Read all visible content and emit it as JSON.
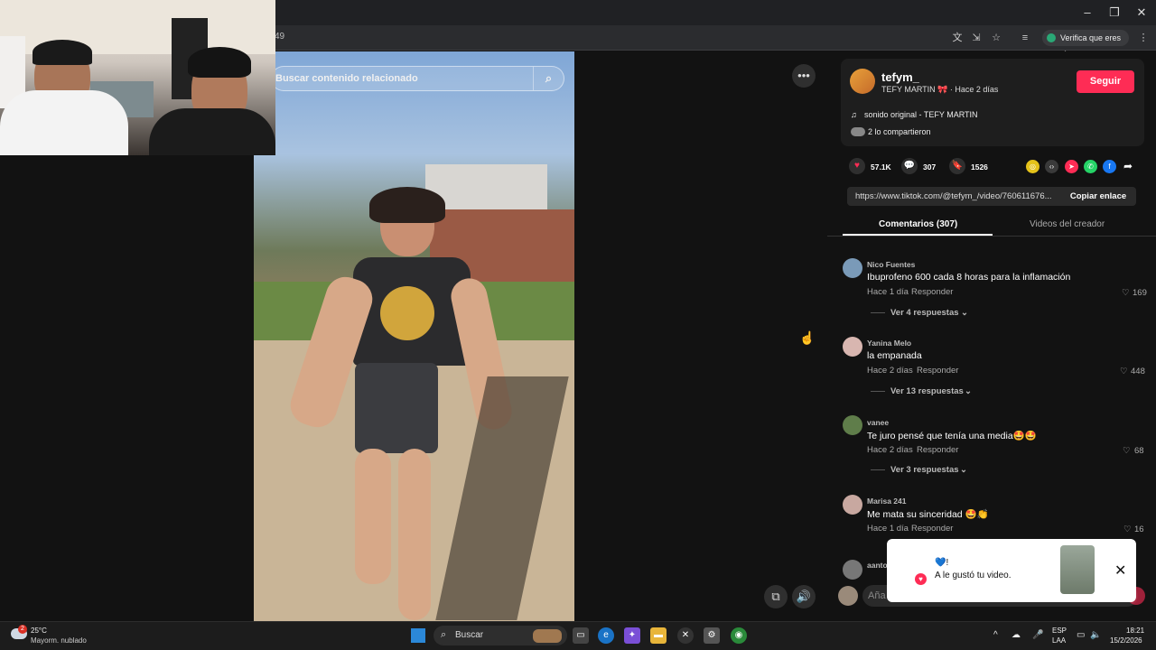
{
  "browser": {
    "url_fragment": "49",
    "verify_chip": "Verifica que eres tú",
    "window_controls": [
      "minimize-icon",
      "restore-icon",
      "close-icon"
    ]
  },
  "video": {
    "search_placeholder": "Buscar contenido relacionado",
    "more_icon": "more-icon",
    "cursor_icon": "hand-cursor-icon"
  },
  "author": {
    "username": "tefym_",
    "display_name": "TEFY MARTIN 🎀 · Hace 2 días",
    "follow_label": "Seguir",
    "sound": "sonido original - TEFY MARTIN",
    "shared": "2 lo compartieron"
  },
  "stats": {
    "likes": "57.1K",
    "comments": "307",
    "saves": "1526"
  },
  "share_colors": [
    "#e5c21a",
    "#3a3a3a",
    "#fe2c55",
    "#25d366",
    "#1877f2"
  ],
  "link": {
    "url": "https://www.tiktok.com/@tefym_/video/760611676...",
    "copy_label": "Copiar enlace"
  },
  "tabs": {
    "comments": "Comentarios (307)",
    "creator_videos": "Videos del creador"
  },
  "comments": [
    {
      "name": "Nico Fuentes",
      "text": "Ibuprofeno 600 cada 8 horas para la inflamación",
      "time": "Hace 1 día",
      "reply": "Responder",
      "likes": "169",
      "replies": "Ver 4 respuestas"
    },
    {
      "name": "Yanina Melo",
      "text": "la empanada",
      "time": "Hace 2 días",
      "reply": "Responder",
      "likes": "448",
      "replies": "Ver 13 respuestas"
    },
    {
      "name": "vanee",
      "text": "Te juro pensé que tenía una media🤩🤩",
      "time": "Hace 2 días",
      "reply": "Responder",
      "likes": "68",
      "replies": "Ver 3 respuestas"
    },
    {
      "name": "Marisa 241",
      "text": "Me mata su sinceridad 🤩👏",
      "time": "Hace 1 día",
      "reply": "Responder",
      "likes": "16"
    },
    {
      "name": "aanto"
    }
  ],
  "toast": {
    "hearts": "💙!",
    "message": "A le gustó tu video."
  },
  "comment_input": {
    "placeholder": "Aña"
  },
  "taskbar": {
    "weather_temp": "25°C",
    "weather_desc": "Mayorm. nublado",
    "weather_badge": "2",
    "search_label": "Buscar",
    "lang1": "ESP",
    "lang2": "LAA",
    "time": "18:21",
    "date": "15/2/2026"
  }
}
